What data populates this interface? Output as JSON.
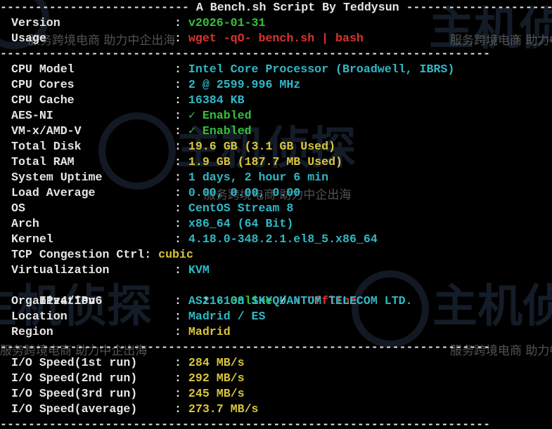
{
  "title": "A Bench.sh Script By Teddysun",
  "header": [
    {
      "label": "Version",
      "value": "v2026-01-31",
      "color": "#35c03a"
    },
    {
      "label": "Usage",
      "value": "wget -qO- bench.sh | bash",
      "color": "#d9332c"
    }
  ],
  "system": [
    {
      "label": "CPU Model",
      "value": "Intel Core Processor (Broadwell, IBRS)",
      "color": "#2fb8c6"
    },
    {
      "label": "CPU Cores",
      "value": "2 @ 2599.996 MHz",
      "color": "#2fb8c6"
    },
    {
      "label": "CPU Cache",
      "value": "16384 KB",
      "color": "#2fb8c6"
    },
    {
      "label": "AES-NI",
      "value": "✓ Enabled",
      "color": "#35c03a"
    },
    {
      "label": "VM-x/AMD-V",
      "value": "✓ Enabled",
      "color": "#35c03a"
    },
    {
      "label": "Total Disk",
      "value": "19.6 GB (3.1 GB Used)",
      "color": "#d9c53b"
    },
    {
      "label": "Total RAM",
      "value": "1.9 GB (187.7 MB Used)",
      "color": "#d9c53b"
    },
    {
      "label": "System Uptime",
      "value": "1 days, 2 hour 6 min",
      "color": "#2fb8c6"
    },
    {
      "label": "Load Average",
      "value": "0.00, 0.00, 0.00",
      "color": "#2fb8c6"
    },
    {
      "label": "OS",
      "value": "CentOS Stream 8",
      "color": "#2fb8c6"
    },
    {
      "label": "Arch",
      "value": "x86_64 (64 Bit)",
      "color": "#2fb8c6"
    },
    {
      "label": "Kernel",
      "value": "4.18.0-348.2.1.el8_5.x86_64",
      "color": "#2fb8c6"
    },
    {
      "label": "TCP Congestion Ctrl",
      "value": "cubic",
      "color": "#d9c53b"
    },
    {
      "label": "Virtualization",
      "value": "KVM",
      "color": "#2fb8c6"
    }
  ],
  "ip_status": {
    "label": "IPv4/IPv6",
    "online": "✓ Online",
    "slash": "/",
    "offline": "✗ Offline",
    "online_color": "#35c03a",
    "offline_color": "#d9332c"
  },
  "network": [
    {
      "label": "Organization",
      "value": "AS216138 SKYQUANTUM TELECOM LTD.",
      "color": "#2fb8c6"
    },
    {
      "label": "Location",
      "value": "Madrid / ES",
      "color": "#2fb8c6"
    },
    {
      "label": "Region",
      "value": "Madrid",
      "color": "#d9c53b"
    }
  ],
  "io": [
    {
      "label": "I/O Speed(1st run)",
      "value": "284 MB/s",
      "color": "#d9c53b"
    },
    {
      "label": "I/O Speed(2nd run)",
      "value": "292 MB/s",
      "color": "#d9c53b"
    },
    {
      "label": "I/O Speed(3rd run)",
      "value": "245 MB/s",
      "color": "#d9c53b"
    },
    {
      "label": "I/O Speed(average)",
      "value": "273.7 MB/s",
      "color": "#d9c53b"
    }
  ],
  "watermark": {
    "big_text": "主机侦探",
    "small_text": "服务跨境电商 助力中企出海"
  },
  "colors": {
    "background": "#000000",
    "label": "#e6e6e6",
    "cyan": "#2fb8c6",
    "yellow": "#d9c53b",
    "green": "#35c03a",
    "red": "#d9332c"
  }
}
